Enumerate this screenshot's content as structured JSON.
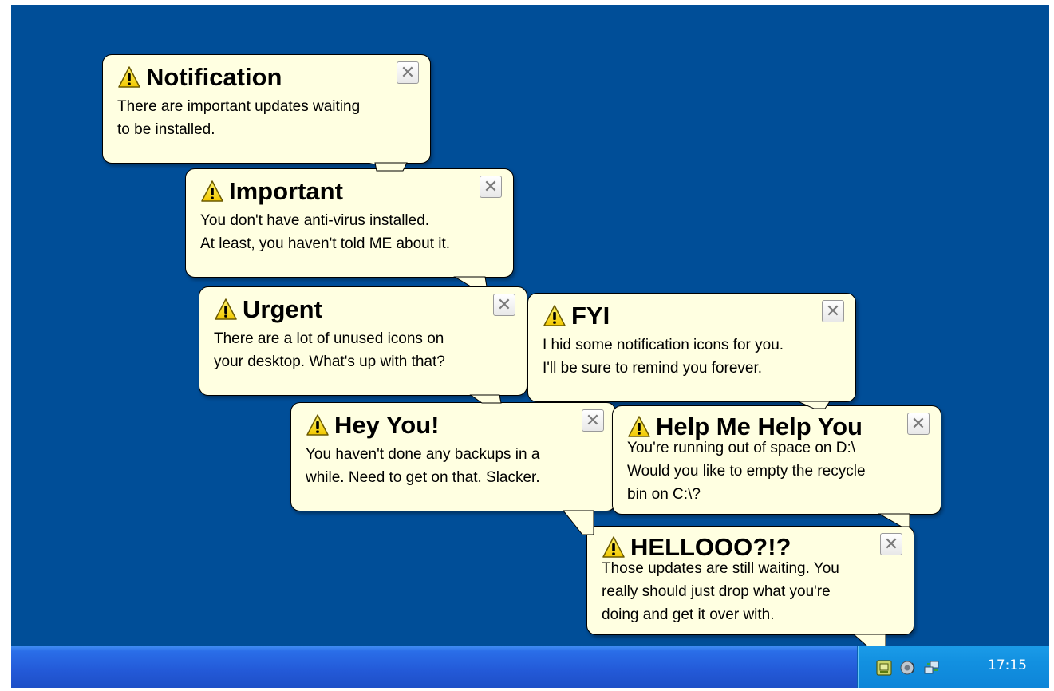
{
  "balloons": [
    {
      "title": "Notification",
      "lines": [
        "There are important updates waiting",
        "to be installed."
      ]
    },
    {
      "title": "Important",
      "lines": [
        "You don't have anti-virus installed.",
        "At least, you haven't told ME about it."
      ]
    },
    {
      "title": "Urgent",
      "lines": [
        "There are a lot of unused icons on",
        "your desktop. What's up with that?"
      ]
    },
    {
      "title": "FYI",
      "lines": [
        "I hid some notification icons for you.",
        "I'll be sure to remind you forever."
      ]
    },
    {
      "title": "Hey You!",
      "lines": [
        "You haven't done any backups in a",
        "while. Need to get on that. Slacker."
      ]
    },
    {
      "title": "Help Me Help You",
      "lines": [
        "You're running out of space on D:\\",
        "Would you like to empty the recycle",
        "bin on C:\\?"
      ]
    },
    {
      "title": "HELLOOO?!?",
      "lines": [
        "Those updates are still waiting. You",
        "really should just drop what you're",
        "doing and get it over with."
      ]
    }
  ],
  "close_glyph": "✕",
  "tray": {
    "clock": "17:15",
    "icons": [
      "updates-tray-icon",
      "speaker-tray-icon",
      "network-tray-icon"
    ]
  },
  "colors": {
    "desktop": "#004e98",
    "balloon": "#ffffe1",
    "taskbar": "#2359d7",
    "tray": "#1290e0"
  }
}
